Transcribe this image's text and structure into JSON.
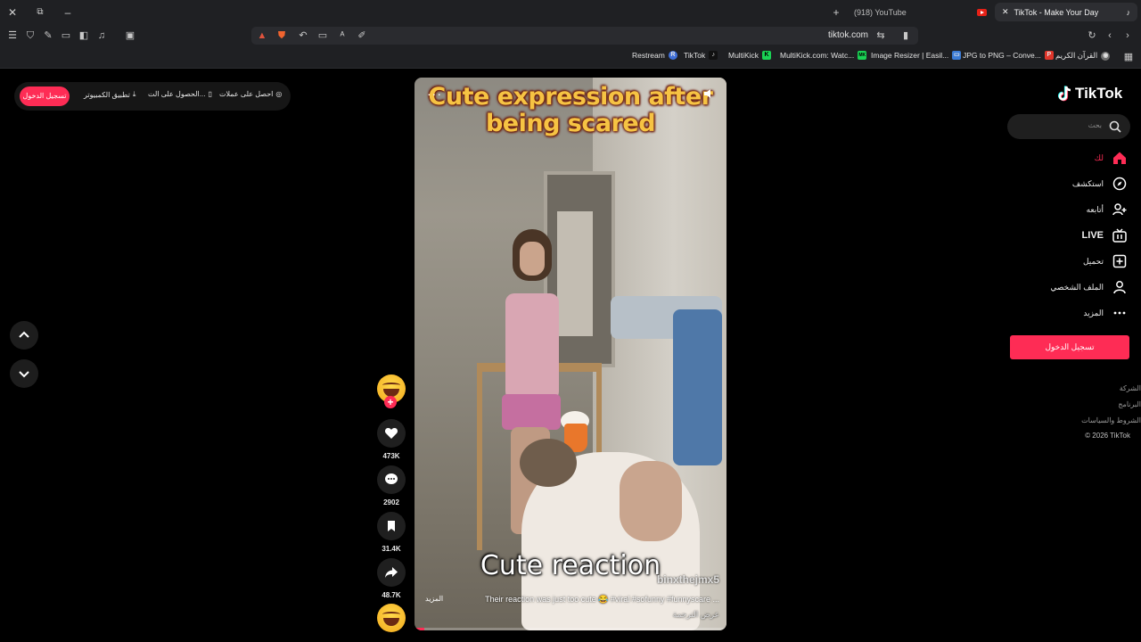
{
  "browser": {
    "tabs": [
      {
        "title": "(918) YouTube",
        "active": false
      },
      {
        "title": "TikTok - Make Your Day",
        "active": true
      }
    ],
    "url": "tiktok.com",
    "bookmarks": [
      {
        "label": "Restream",
        "icon": "R",
        "color": "#3f6fd8"
      },
      {
        "label": "TikTok",
        "icon": "♪",
        "color": "#111111"
      },
      {
        "label": "MultiKick",
        "icon": "K",
        "color": "#1ad254"
      },
      {
        "label": "MultiKick.com: Watc...",
        "icon": "MK",
        "color": "#1ad254"
      },
      {
        "label": "Image Resizer | Easil...",
        "icon": "▭",
        "color": "#3a7bd5"
      },
      {
        "label": "JPG to PNG – Conve...",
        "icon": "P",
        "color": "#e0362b"
      },
      {
        "label": "القرآن الكريم",
        "icon": "◉",
        "color": "#6e6e6e"
      }
    ]
  },
  "top_pill": {
    "login": "تسجيل الدخول",
    "desktop_app": "تطبيق الكمبيوتر",
    "get_app": "الحصول على الت...",
    "get_coins": "احصل على عملات"
  },
  "video": {
    "caption_top_line1": "Cute expression after",
    "caption_top_line2": "being scared",
    "caption_bottom": "Cute reaction",
    "watermark": "binxthejmx5",
    "description": "Their reaction was just too cute 😂 #viral #sofunny #funnyscare ...",
    "more": "المزيد",
    "translate": "عرض الترجمة",
    "progress_fraction": 0.03
  },
  "actions": {
    "likes": "473K",
    "comments": "2902",
    "saves": "31.4K",
    "shares": "48.7K"
  },
  "sidebar": {
    "logo": "TikTok",
    "search_placeholder": "بحث",
    "nav": [
      {
        "label": "لك",
        "icon": "home-icon"
      },
      {
        "label": "استكشف",
        "icon": "compass-icon"
      },
      {
        "label": "أتابعه",
        "icon": "follow-icon"
      },
      {
        "label": "LIVE",
        "icon": "live-icon"
      },
      {
        "label": "تحميل",
        "icon": "upload-icon"
      },
      {
        "label": "الملف الشخصي",
        "icon": "profile-icon"
      },
      {
        "label": "المزيد",
        "icon": "more-icon"
      }
    ],
    "login_button": "تسجيل الدخول",
    "footer": [
      "الشركة",
      "البرنامج",
      "الشروط والسياسات",
      "© 2026 TikTok"
    ]
  },
  "colors": {
    "accent": "#fe2c55",
    "background": "#000000"
  }
}
